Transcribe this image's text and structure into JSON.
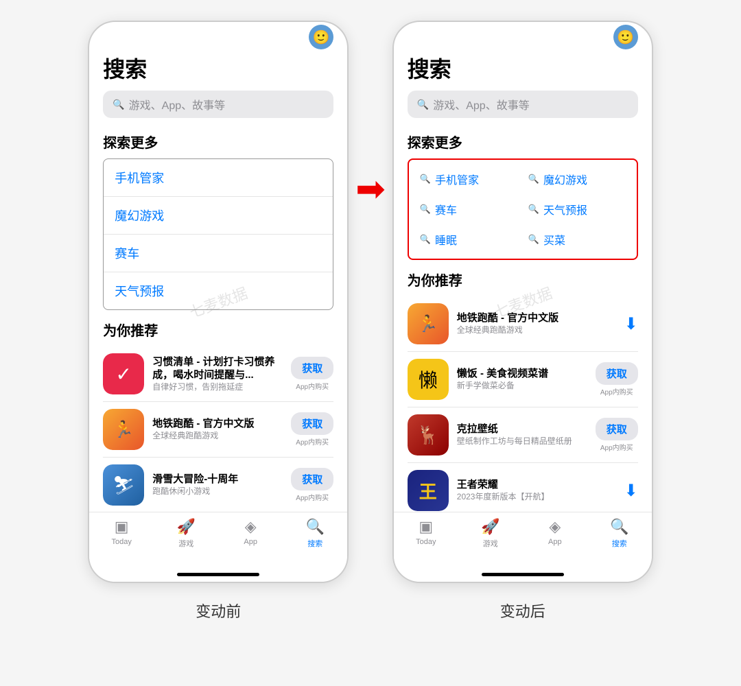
{
  "page": {
    "background": "#f5f5f5"
  },
  "left_panel": {
    "label": "变动前",
    "title": "搜索",
    "search_placeholder": "游戏、App、故事等",
    "section_explore": "探索更多",
    "explore_items": [
      "手机管家",
      "魔幻游戏",
      "赛车",
      "天气预报"
    ],
    "section_recommend": "为你推荐",
    "apps": [
      {
        "name": "习惯清单 - 计划打卡习惯养成，喝水时间提醒与...",
        "desc": "自律好习惯，告别拖延症",
        "action": "获取",
        "sub": "App内购买"
      },
      {
        "name": "地铁跑酷 - 官方中文版",
        "desc": "全球经典跑酷游戏",
        "action": "获取",
        "sub": "App内购买"
      },
      {
        "name": "滑雪大冒险-十周年",
        "desc": "跑酷休闲小游戏",
        "action": "获取",
        "sub": "App内购买"
      }
    ],
    "tabs": [
      "Today",
      "游戏",
      "App",
      "搜索"
    ],
    "tab_active": 3
  },
  "right_panel": {
    "label": "变动后",
    "title": "搜索",
    "search_placeholder": "游戏、App、故事等",
    "section_explore": "探索更多",
    "explore_grid": [
      [
        "手机管家",
        "魔幻游戏"
      ],
      [
        "赛车",
        "天气预报"
      ],
      [
        "睡眠",
        "买菜"
      ]
    ],
    "section_recommend": "为你推荐",
    "apps": [
      {
        "name": "地铁跑酷 - 官方中文版",
        "desc": "全球经典跑酷游戏",
        "action": "cloud",
        "sub": ""
      },
      {
        "name": "懒饭 - 美食视频菜谱",
        "desc": "新手学做菜必备",
        "action": "获取",
        "sub": "App内购买"
      },
      {
        "name": "克拉壁纸",
        "desc": "壁纸制作工坊与每日精品壁纸册",
        "action": "获取",
        "sub": "App内购买"
      },
      {
        "name": "王者荣耀",
        "desc": "2023年度新版本【开航】",
        "action": "cloud",
        "sub": ""
      }
    ],
    "tabs": [
      "Today",
      "游戏",
      "App",
      "搜索"
    ],
    "tab_active": 3
  },
  "arrow": "→",
  "watermark": "七麦数据",
  "icons": {
    "today": "▣",
    "games": "🚀",
    "app": "◈",
    "search": "🔍",
    "search_small": "🔍",
    "avatar": "🙂",
    "cloud": "⬇",
    "check": "✓"
  }
}
